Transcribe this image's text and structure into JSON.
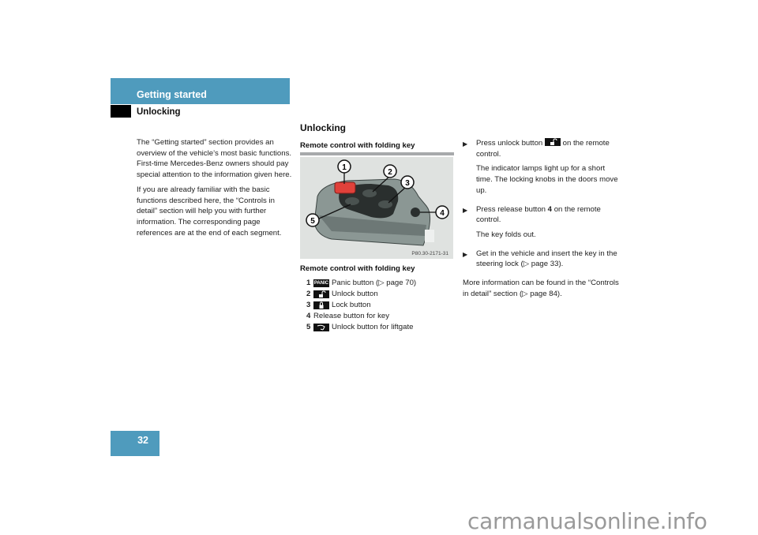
{
  "header": {
    "chapter_title": "Getting started",
    "section_label": "Unlocking"
  },
  "intro": {
    "paragraphs": [
      "The “Getting started” section provides an overview of the vehicle’s most basic functions. First-time Mercedes-Benz owners should pay special attention to the information given here.",
      "If you are already familiar with the basic functions described here, the “Controls in detail” section will help you with further information. The corresponding page references are at the end of each segment."
    ]
  },
  "main": {
    "heading": "Unlocking",
    "subheading": "Remote control with folding key",
    "figure": {
      "code": "P80.30-2171-31",
      "callouts": [
        "1",
        "2",
        "3",
        "4",
        "5"
      ]
    },
    "caption": "Remote control with folding key",
    "legend": [
      {
        "num": "1",
        "icon": "panic-icon",
        "icon_text": "PANIC",
        "label": "Panic button (▷ page 70)"
      },
      {
        "num": "2",
        "icon": "unlock-icon",
        "icon_text": "",
        "label": "Unlock button"
      },
      {
        "num": "3",
        "icon": "lock-icon",
        "icon_text": "",
        "label": "Lock button"
      },
      {
        "num": "4",
        "icon": "",
        "icon_text": "",
        "label": "Release button for key"
      },
      {
        "num": "5",
        "icon": "liftgate-icon",
        "icon_text": "",
        "label": "Unlock button for liftgate"
      }
    ]
  },
  "steps": {
    "bullet_glyph": "▶",
    "step1_pre": "Press unlock button",
    "step1_post": "on the remote control.",
    "step1_note": "The indicator lamps light up for a short time. The locking knobs in the doors move up.",
    "step2_pre": "Press release button",
    "step2_ref": "4",
    "step2_post": "on the remote control.",
    "step2_note": "The key folds out.",
    "step3": "Get in the vehicle and insert the key in the steering lock (▷ page 33).",
    "more_info": "More information can be found in the “Controls in detail” section (▷ page 84)."
  },
  "footer": {
    "page_number": "32",
    "watermark": "carmanualsonline.info"
  }
}
